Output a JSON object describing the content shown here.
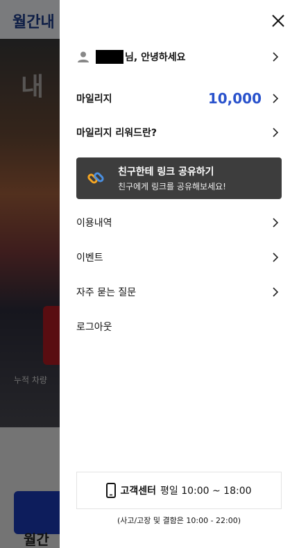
{
  "background": {
    "logo_text": "월간내",
    "hero_text": "내",
    "stat_text": "누적 차량",
    "bottom_text": "월간"
  },
  "drawer": {
    "user": {
      "greeting": "님, 안녕하세요"
    },
    "mileage": {
      "label": "마일리지",
      "value": "10,000"
    },
    "reward": {
      "label": "마일리지 리워드란?"
    },
    "share": {
      "title": "친구한테 링크 공유하기",
      "subtitle": "친구에게 링크를 공유해보세요!"
    },
    "menu": {
      "history": "이용내역",
      "events": "이벤트",
      "faq": "자주 묻는 질문",
      "logout": "로그아웃"
    },
    "support": {
      "title": "고객센터",
      "hours": "평일 10:00 ~ 18:00",
      "note": "(사고/고장 및 결함은 10:00 - 22:00)"
    }
  },
  "colors": {
    "accent": "#2952cc",
    "share_card": "#3d3d3d",
    "overlay": "rgba(0,0,0,0.5)"
  },
  "icons": {
    "user": "user-icon",
    "close": "close-icon",
    "chevron": "chevron-right-icon",
    "link": "link-icon",
    "phone": "phone-icon"
  }
}
